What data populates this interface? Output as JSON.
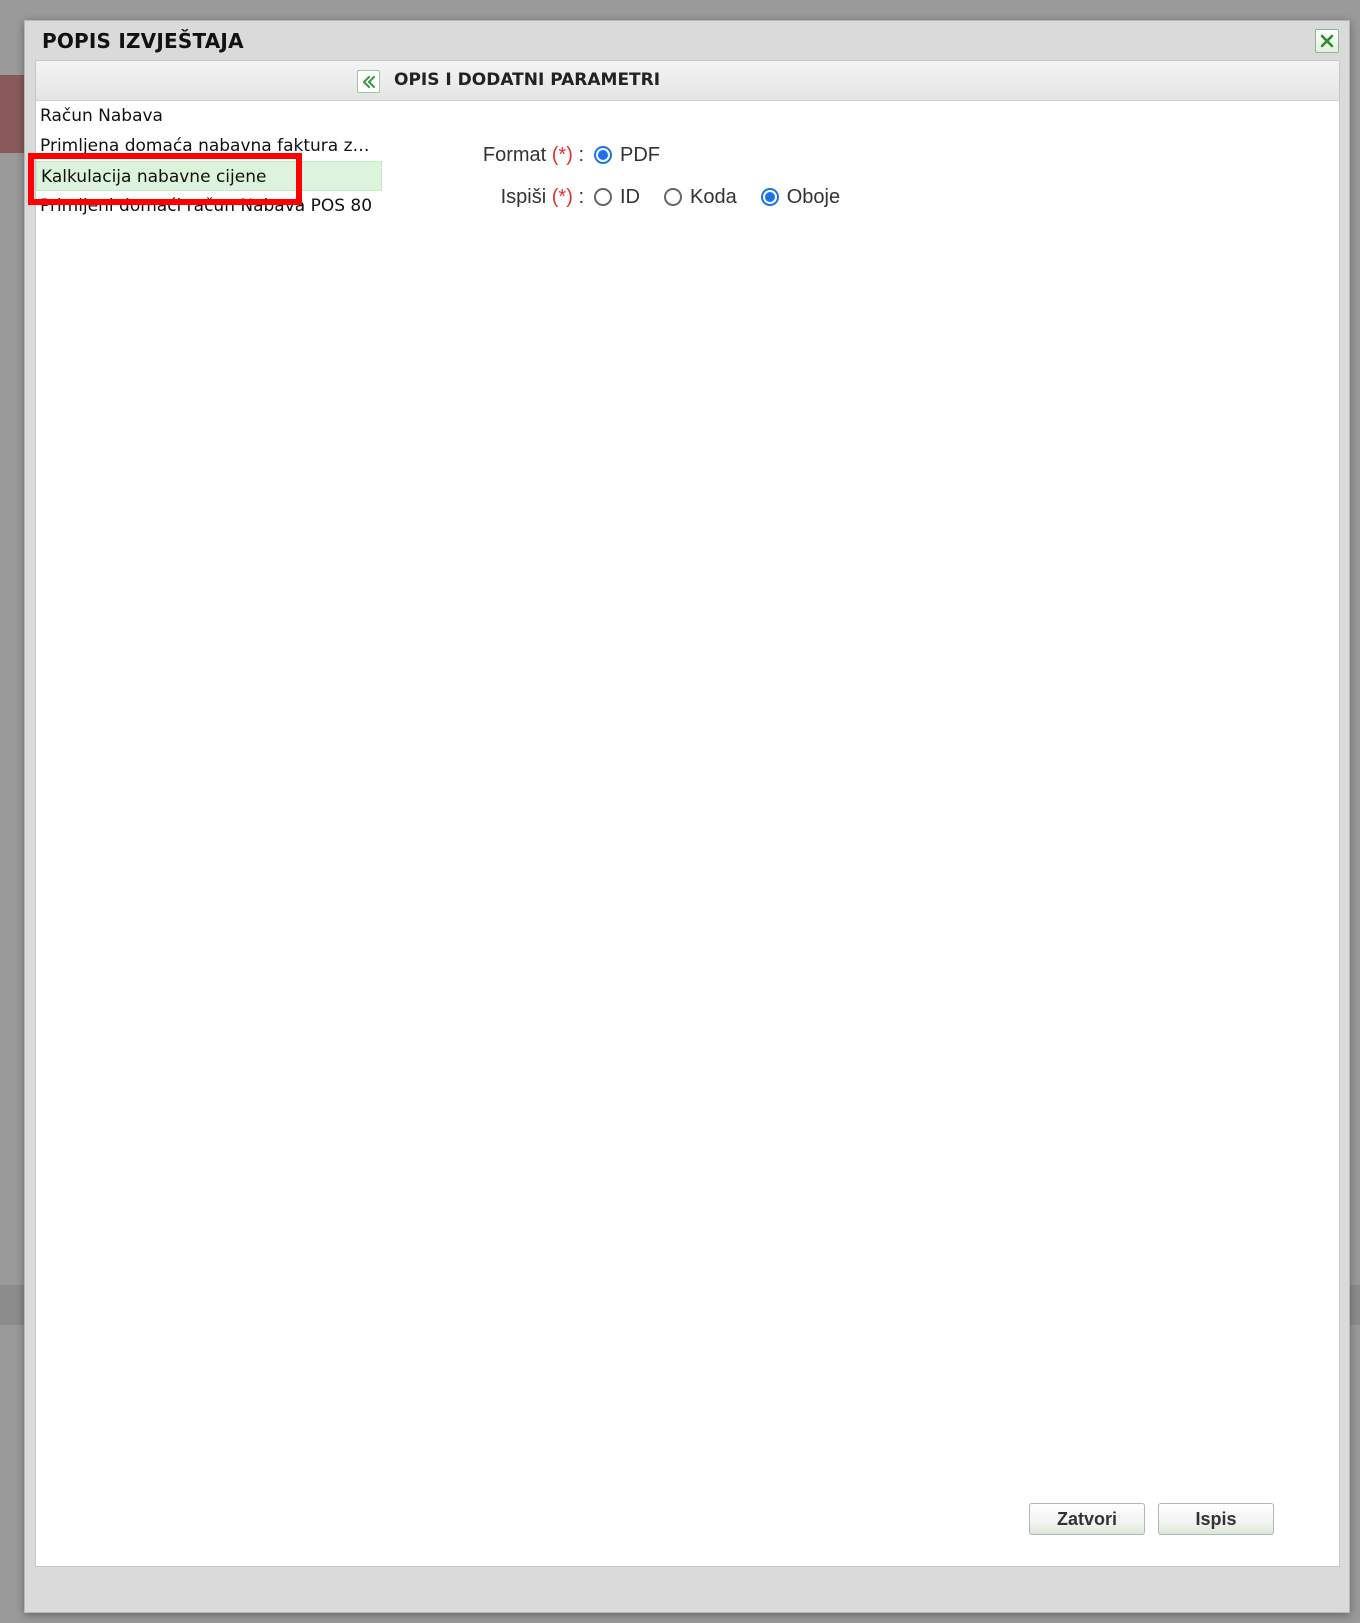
{
  "dialog": {
    "title": "POPIS IZVJEŠTAJA",
    "close_icon": "close-x-icon"
  },
  "left_panel": {
    "collapse_icon": "double-chevron-left-icon",
    "reports": [
      {
        "label": "Račun Nabava",
        "selected": false
      },
      {
        "label": "Primljena domaća nabavna faktura za p...",
        "selected": false
      },
      {
        "label": "Kalkulacija nabavne cijene",
        "selected": true
      },
      {
        "label": "Primljeni domaći račun Nabava POS 80",
        "selected": false
      }
    ]
  },
  "right_panel": {
    "header": "OPIS I DODATNI PARAMETRI",
    "params": {
      "format": {
        "label": "Format",
        "required_mark": "(*)",
        "separator": ":",
        "options": [
          {
            "label": "PDF",
            "checked": true
          }
        ]
      },
      "ispisi": {
        "label": "Ispiši",
        "required_mark": "(*)",
        "separator": ":",
        "options": [
          {
            "label": "ID",
            "checked": false
          },
          {
            "label": "Koda",
            "checked": false
          },
          {
            "label": "Oboje",
            "checked": true
          }
        ]
      }
    }
  },
  "footer": {
    "close_label": "Zatvori",
    "print_label": "Ispis"
  },
  "colors": {
    "accent_green": "#4caf50",
    "selected_row": "#dcf3dc",
    "required": "#e53030",
    "radio_checked": "#1a73e8",
    "annotation": "#ff0000"
  }
}
